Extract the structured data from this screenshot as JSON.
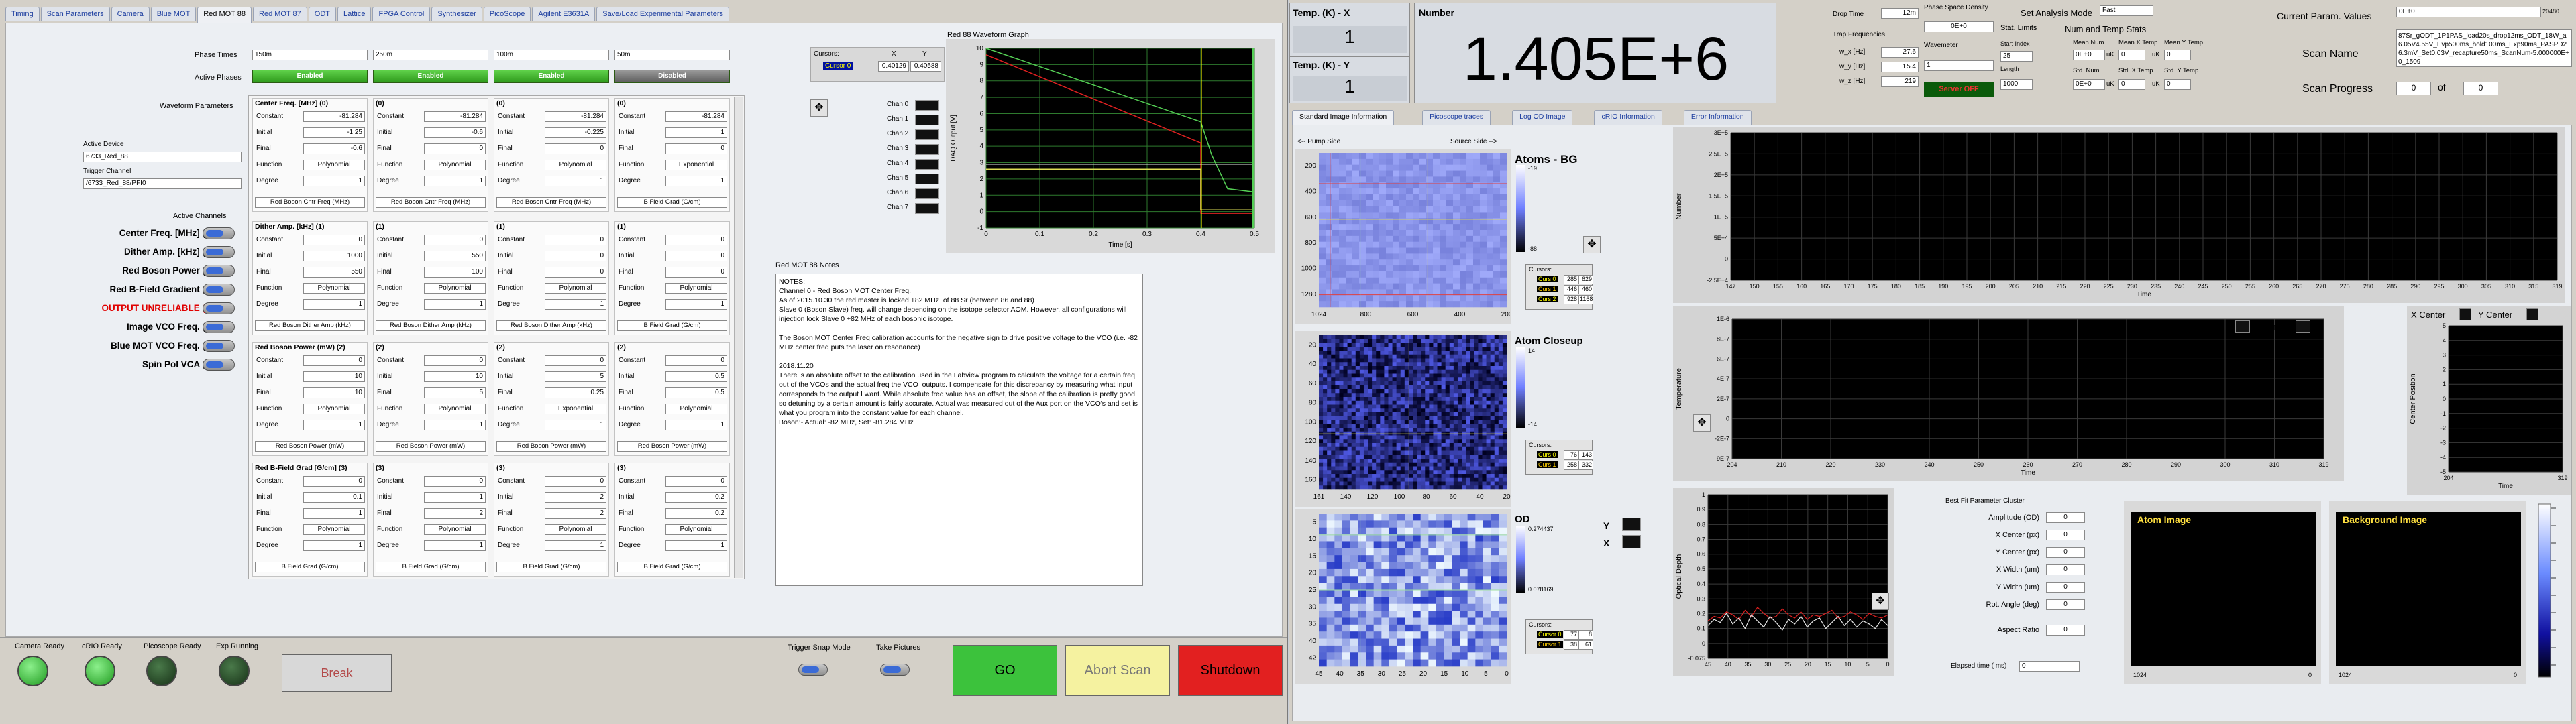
{
  "tabs": [
    "Timing",
    "Scan Parameters",
    "Camera",
    "Blue MOT",
    "Red MOT 88",
    "Red MOT 87",
    "ODT",
    "Lattice",
    "FPGA Control",
    "Synthesizer",
    "PicoScope",
    "Agilent E3631A",
    "Save/Load Experimental Parameters"
  ],
  "active_tab": "Red MOT 88",
  "phase_times": {
    "label": "Phase Times",
    "values": [
      "150m",
      "250m",
      "100m",
      "50m"
    ]
  },
  "active_phases": {
    "label": "Active Phases",
    "values": [
      "Enabled",
      "Enabled",
      "Enabled",
      "Disabled"
    ]
  },
  "waveform_label": "Waveform Parameters",
  "active_device": {
    "label": "Active Device",
    "value": "6733_Red_88"
  },
  "trigger_channel": {
    "label": "Trigger Channel",
    "value": "/6733_Red_88/PFI0"
  },
  "active_channels": {
    "label": "Active Channels",
    "items": [
      "Center Freq. [MHz] (0)",
      "Dither Amp. [kHz] (1)",
      "Red Boson Power (2)",
      "Red B-Field Gradient (3)",
      "OUTPUT UNRELIABLE (4)",
      "Image VCO Freq. (5)",
      "Blue MOT VCO Freq. (6)",
      "Spin Pol VCA (7)"
    ]
  },
  "row_labels": [
    "Constant",
    "Initial",
    "Final",
    "Function",
    "Degree"
  ],
  "groups": [
    {
      "cols": [
        {
          "head": "Center Freq. [MHz] (0)",
          "vals": [
            "-81.284",
            "-1.25",
            "-0.6",
            "Polynomial",
            "1"
          ],
          "foot": "Red Boson Cntr Freq (MHz)"
        },
        {
          "head": "(0)",
          "vals": [
            "-81.284",
            "-0.6",
            "0",
            "Polynomial",
            "1"
          ],
          "foot": "Red Boson Cntr Freq (MHz)"
        },
        {
          "head": "(0)",
          "vals": [
            "-81.284",
            "-0.225",
            "0",
            "Polynomial",
            "1"
          ],
          "foot": "Red Boson Cntr Freq (MHz)"
        },
        {
          "head": "(0)",
          "vals": [
            "-81.284",
            "1",
            "0",
            "Exponential",
            "1"
          ],
          "foot": "B Field Grad (G/cm)"
        }
      ]
    },
    {
      "cols": [
        {
          "head": "Dither Amp. [kHz] (1)",
          "vals": [
            "0",
            "1000",
            "550",
            "Polynomial",
            "1"
          ],
          "foot": "Red Boson Dither Amp (kHz)"
        },
        {
          "head": "(1)",
          "vals": [
            "0",
            "550",
            "100",
            "Polynomial",
            "1"
          ],
          "foot": "Red Boson Dither Amp (kHz)"
        },
        {
          "head": "(1)",
          "vals": [
            "0",
            "0",
            "0",
            "Polynomial",
            "1"
          ],
          "foot": "Red Boson Dither Amp (kHz)"
        },
        {
          "head": "(1)",
          "vals": [
            "0",
            "0",
            "0",
            "Polynomial",
            "1"
          ],
          "foot": "B Field Grad (G/cm)"
        }
      ]
    },
    {
      "cols": [
        {
          "head": "Red Boson Power (mW) (2)",
          "vals": [
            "0",
            "10",
            "10",
            "Polynomial",
            "1"
          ],
          "foot": "Red Boson Power (mW)"
        },
        {
          "head": "(2)",
          "vals": [
            "0",
            "10",
            "5",
            "Polynomial",
            "1"
          ],
          "foot": "Red Boson Power (mW)"
        },
        {
          "head": "(2)",
          "vals": [
            "0",
            "5",
            "0.25",
            "Exponential",
            "1"
          ],
          "foot": "Red Boson Power (mW)"
        },
        {
          "head": "(2)",
          "vals": [
            "0",
            "0.5",
            "0.5",
            "Polynomial",
            "1"
          ],
          "foot": "Red Boson Power (mW)"
        }
      ]
    },
    {
      "cols": [
        {
          "head": "Red B-Field Grad [G/cm] (3)",
          "vals": [
            "0",
            "0.1",
            "1",
            "Polynomial",
            "1"
          ],
          "foot": "B Field Grad (G/cm)"
        },
        {
          "head": "(3)",
          "vals": [
            "0",
            "1",
            "2",
            "Polynomial",
            "1"
          ],
          "foot": "B Field Grad (G/cm)"
        },
        {
          "head": "(3)",
          "vals": [
            "0",
            "2",
            "2",
            "Polynomial",
            "1"
          ],
          "foot": "B Field Grad (G/cm)"
        },
        {
          "head": "(3)",
          "vals": [
            "0",
            "0.2",
            "0.2",
            "Polynomial",
            "1"
          ],
          "foot": "B Field Grad (G/cm)"
        }
      ]
    }
  ],
  "cursors": {
    "label": "Cursors:",
    "x": "X",
    "y": "Y",
    "name": "Cursor 0",
    "xv": "0.40129",
    "yv": "0.40588"
  },
  "chan_list": [
    "Chan 0",
    "Chan 1",
    "Chan 2",
    "Chan 3",
    "Chan 4",
    "Chan 5",
    "Chan 6",
    "Chan 7"
  ],
  "waveform_graph": {
    "title": "Red 88 Waveform Graph",
    "xlabel": "Time [s]",
    "ylabel": "DAQ Output [V]",
    "xticks": [
      "0",
      "0.1",
      "0.2",
      "0.3",
      "0.4",
      "0.5"
    ],
    "yticks": [
      "10",
      "9",
      "8",
      "7",
      "6",
      "5",
      "4",
      "3",
      "2",
      "1",
      "0",
      "-1"
    ]
  },
  "notes": {
    "title": "Red MOT 88 Notes",
    "text": "NOTES:\nChannel 0 - Red Boson MOT Center Freq.\nAs of 2015.10.30 the red master is locked +82 MHz  of 88 Sr (between 86 and 88)\nSlave 0 (Boson Slave) freq. will change depending on the isotope selector AOM. However, all configurations will injection lock Slave 0 +82 MHz of each bosonic isotope.\n\nThe Boson MOT Center Freq calibration accounts for the negative sign to drive positive voltage to the VCO (i.e. -82 MHz center freq puts the laser on resonance)\n\n2018.11.20\nThere is an absolute offset to the calibration used in the Labview program to calculate the voltage for a certain freq out of the VCOs and the actual freq the VCO  outputs. I compensate for this discrepancy by measuring what input corresponds to the output I want. While absolute freq value has an offset, the slope of the calibration is pretty good so detuning by a certain amount is fairly accurate. Actual was measured out of the Aux port on the VCO's and set is what you program into the constant value for each channel.\nBoson:- Actual: -82 MHz, Set: -81.284 MHz"
  },
  "status_leds": [
    {
      "label": "Camera Ready"
    },
    {
      "label": "cRIO Ready"
    },
    {
      "label": "Picoscope Ready"
    },
    {
      "label": "Exp Running"
    }
  ],
  "break_label": "Break",
  "trigger_snap": "Trigger Snap Mode",
  "take_pictures": "Take Pictures",
  "go_label": "GO",
  "abort_label": "Abort Scan",
  "shutdown_label": "Shutdown",
  "temp_x": {
    "label": "Temp. (K) - X",
    "value": "1"
  },
  "temp_y": {
    "label": "Temp. (K) - Y",
    "value": "1"
  },
  "number": {
    "label": "Number",
    "value": "1.405E+6"
  },
  "drop_time": {
    "label": "Drop Time",
    "value": "12m"
  },
  "trap_freq": {
    "label": "Trap Frequencies",
    "rows": [
      {
        "l": "w_x [Hz]",
        "v": "27.6"
      },
      {
        "l": "w_y [Hz]",
        "v": "15.4"
      },
      {
        "l": "w_z [Hz]",
        "v": "219"
      }
    ]
  },
  "psd": {
    "label": "Phase Space Density",
    "value": "0E+0"
  },
  "wavemeter": {
    "label": "Wavemeter",
    "value": "1",
    "status": "Server OFF"
  },
  "analysis_mode": {
    "label": "Set Analysis Mode",
    "value": "Fast"
  },
  "stat_limits": {
    "label": "Stat. Limits",
    "start_label": "Start Index",
    "start": "25",
    "length_label": "Length",
    "length": "1000"
  },
  "num_temp": {
    "label": "Num and Temp Stats",
    "headers": [
      "Mean Num.",
      "Mean X Temp",
      "Mean Y Temp"
    ],
    "sd_headers": [
      "Std. Num.",
      "Std. X Temp",
      "Std. Y Temp"
    ],
    "means": [
      "0E+0",
      "0",
      "0"
    ],
    "stds": [
      "0E+0",
      "0",
      "0"
    ],
    "units": [
      "uK",
      "uK"
    ]
  },
  "current_param": {
    "label": "Current Param. Values",
    "value": "0E+0",
    "arrow": "20480"
  },
  "scan_name": {
    "label": "Scan Name",
    "value": "87Sr_gODT_1P1PAS_load20s_drop12ms_ODT_18W_a6.05V4.55V_Evp500ms_hold100ms_Exp90ms_PASPD26.3mV_Set0.03V_recapture50ms_ScanNum-5.000000E+0_1509"
  },
  "scan_progress": {
    "label": "Scan Progress",
    "current": "0",
    "of": "of",
    "total": "0"
  },
  "rtabs": [
    "Standard Image Information",
    "Picoscope traces",
    "Log OD Image",
    "cRIO Information",
    "Error Information"
  ],
  "pump_side": "<-- Pump Side",
  "source_side": "Source Side -->",
  "atoms_bg": {
    "label": "Atoms - BG",
    "cursors": [
      {
        "n": "Curs 0",
        "x": "285",
        "y": "629"
      },
      {
        "n": "Curs 1",
        "x": "446",
        "y": "460"
      },
      {
        "n": "Curs 2",
        "x": "928",
        "y": "1168"
      }
    ],
    "xticks": [
      "1024",
      "800",
      "600",
      "400",
      "200"
    ],
    "yticks": [
      "200",
      "400",
      "600",
      "800",
      "1000",
      "1280"
    ],
    "scale": [
      "-19",
      "-88"
    ]
  },
  "atom_closeup": {
    "label": "Atom Closeup",
    "cursors": [
      {
        "n": "Curs 0",
        "x": "76",
        "y": "143"
      },
      {
        "n": "Curs 1",
        "x": "258",
        "y": "332"
      }
    ],
    "xticks": [
      "161",
      "140",
      "120",
      "100",
      "80",
      "60",
      "40",
      "20"
    ],
    "yticks": [
      "20",
      "40",
      "60",
      "80",
      "100",
      "120",
      "140",
      "160"
    ],
    "scale": [
      "14",
      "-14"
    ]
  },
  "od": {
    "label": "OD",
    "cursors": [
      {
        "n": "Cursor 0",
        "x": "77",
        "y": "8"
      },
      {
        "n": "Cursor 1",
        "x": "38",
        "y": "61"
      }
    ],
    "xticks": [
      "45",
      "40",
      "35",
      "30",
      "25",
      "20",
      "15",
      "10",
      "5",
      "0"
    ],
    "yticks": [
      "5",
      "10",
      "15",
      "20",
      "25",
      "30",
      "35",
      "40",
      "42"
    ],
    "scale": [
      "0.274437",
      "0.078169"
    ],
    "y_label": "Y",
    "x_label": "X"
  },
  "num_plot": {
    "ylabel": "Number",
    "xlabel": "Time",
    "yticks": [
      "3E+5",
      "2.5E+5",
      "2E+5",
      "1.5E+5",
      "1E+5",
      "5E+4",
      "0",
      "-2.5E+4"
    ],
    "xticks": [
      "147",
      "150",
      "155",
      "160",
      "165",
      "170",
      "175",
      "180",
      "185",
      "190",
      "195",
      "200",
      "205",
      "210",
      "215",
      "220",
      "225",
      "230",
      "235",
      "240",
      "245",
      "250",
      "255",
      "260",
      "265",
      "270",
      "275",
      "280",
      "285",
      "290",
      "295",
      "300",
      "305",
      "310",
      "315",
      "319"
    ]
  },
  "temp_plot": {
    "ylabel": "Temperature",
    "xlabel": "Time",
    "legend": [
      "X Temp",
      "Y Temp"
    ],
    "yticks": [
      "1E-6",
      "8E-7",
      "6E-7",
      "4E-7",
      "2E-7",
      "0",
      "-2E-7",
      "9E-7"
    ],
    "xticks": [
      "204",
      "210",
      "220",
      "230",
      "240",
      "250",
      "260",
      "270",
      "280",
      "290",
      "300",
      "310",
      "319"
    ]
  },
  "center_plot": {
    "ylabel": "Center Position",
    "xlabel": "Time",
    "legend": [
      "X Center",
      "Y Center"
    ],
    "yticks": [
      "5",
      "4",
      "3",
      "2",
      "1",
      "0",
      "-1",
      "-2",
      "-3",
      "-4",
      "-5"
    ],
    "xticks": [
      "204",
      "319"
    ]
  },
  "od_plot": {
    "ylabel": "Optical Depth",
    "yticks": [
      "1",
      "0.9",
      "0.8",
      "0.7",
      "0.6",
      "0.5",
      "0.4",
      "0.3",
      "0.2",
      "0.1",
      "0",
      "-0.075"
    ],
    "xticks": [
      "45",
      "40",
      "35",
      "30",
      "25",
      "20",
      "15",
      "10",
      "5",
      "0"
    ],
    "series_a": [
      0.17,
      0.2,
      0.19,
      0.23,
      0.21,
      0.18,
      0.24,
      0.2,
      0.26,
      0.22,
      0.19,
      0.2,
      0.25,
      0.21,
      0.19,
      0.23,
      0.18,
      0.21,
      0.2,
      0.22,
      0.24,
      0.19,
      0.2,
      0.23,
      0.21,
      0.18,
      0.22,
      0.2,
      0.19,
      0.21
    ],
    "series_b": [
      0.14,
      0.18,
      0.16,
      0.22,
      0.15,
      0.19,
      0.12,
      0.21,
      0.17,
      0.13,
      0.2,
      0.16,
      0.11,
      0.18,
      0.15,
      0.2,
      0.13,
      0.17,
      0.19,
      0.12,
      0.16,
      0.2,
      0.14,
      0.18,
      0.13,
      0.17,
      0.15,
      0.12,
      0.18,
      0.14
    ]
  },
  "fit_params": {
    "title": "Best Fit Parameter Cluster",
    "rows": [
      {
        "l": "Amplitude (OD)",
        "v": "0"
      },
      {
        "l": "X Center (px)",
        "v": "0"
      },
      {
        "l": "Y Center (px)",
        "v": "0"
      },
      {
        "l": "X Width (um)",
        "v": "0"
      },
      {
        "l": "Y Width (um)",
        "v": "0"
      },
      {
        "l": "Rot. Angle (deg)",
        "v": "0"
      },
      {
        "l": "Aspect Ratio",
        "v": "0"
      }
    ]
  },
  "elapsed": {
    "label": "Elapsed time ( ms)",
    "value": "0"
  },
  "atom_image": {
    "title": "Atom Image",
    "xticks": [
      "1024",
      "0"
    ]
  },
  "bg_image": {
    "title": "Background Image",
    "xticks": [
      "1024",
      "0"
    ]
  }
}
